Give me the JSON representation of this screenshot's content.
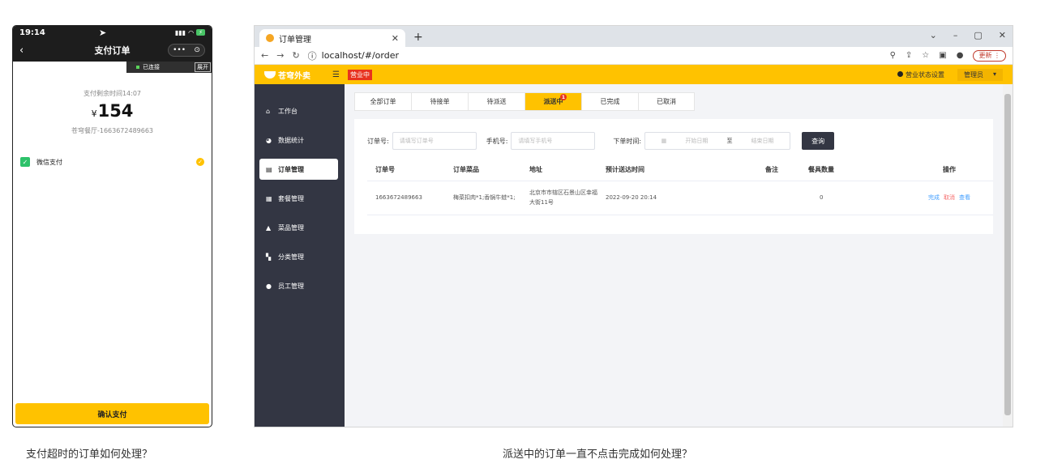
{
  "phone": {
    "time": "19:14",
    "nav_title": "支付订单",
    "capsule_more": "•••",
    "capsule_target": "⊙",
    "connected": "已连接",
    "expand": "展开",
    "remaining_time": "支付剩余时间14:07",
    "currency": "¥",
    "amount": "154",
    "shop_order": "苍穹餐厅-1663672489663",
    "pay_method": "微信支付",
    "confirm": "确认支付"
  },
  "browser": {
    "tab_title": "订单管理",
    "url_scheme_icon": "ⓘ",
    "url": "localhost/#/order",
    "update_label": "更新",
    "app": {
      "logo": "苍穹外卖",
      "status": "营业中",
      "store_settings": "营业状态设置",
      "admin": "管理员"
    },
    "sidebar": [
      {
        "icon": "house-icon",
        "glyph": "⌂",
        "label": "工作台",
        "active": false
      },
      {
        "icon": "chart-icon",
        "glyph": "◕",
        "label": "数据统计",
        "active": false
      },
      {
        "icon": "order-icon",
        "glyph": "▤",
        "label": "订单管理",
        "active": true
      },
      {
        "icon": "combo-icon",
        "glyph": "▦",
        "label": "套餐管理",
        "active": false
      },
      {
        "icon": "dish-icon",
        "glyph": "▲",
        "label": "菜品管理",
        "active": false
      },
      {
        "icon": "category-icon",
        "glyph": "▚",
        "label": "分类管理",
        "active": false
      },
      {
        "icon": "staff-icon",
        "glyph": "●",
        "label": "员工管理",
        "active": false
      }
    ],
    "tabs": [
      {
        "label": "全部订单",
        "active": false
      },
      {
        "label": "待接单",
        "active": false
      },
      {
        "label": "待派送",
        "active": false
      },
      {
        "label": "派送中",
        "active": true,
        "badge": "1"
      },
      {
        "label": "已完成",
        "active": false
      },
      {
        "label": "已取消",
        "active": false
      }
    ],
    "filters": {
      "order_no_label": "订单号:",
      "order_no_placeholder": "请填写订单号",
      "phone_label": "手机号:",
      "phone_placeholder": "请填写手机号",
      "time_label": "下单时间:",
      "start_placeholder": "开始日期",
      "to": "至",
      "end_placeholder": "结束日期",
      "search": "查询"
    },
    "table": {
      "headers": [
        "订单号",
        "订单菜品",
        "地址",
        "预计送达时间",
        "备注",
        "餐具数量",
        "操作"
      ],
      "rows": [
        {
          "order_no": "1663672489663",
          "dishes": "梅菜扣肉*1;香锅牛蛙*1;",
          "address": "北京市市辖区石景山区幸福大街11号",
          "eta": "2022-09-20 20:14",
          "remark": "",
          "tableware": "0",
          "ops": {
            "done": "完成",
            "cancel": "取消",
            "view": "查看"
          }
        }
      ]
    }
  },
  "captions": {
    "left": "支付超时的订单如何处理？",
    "right": "派送中的订单一直不点击完成如何处理？"
  }
}
